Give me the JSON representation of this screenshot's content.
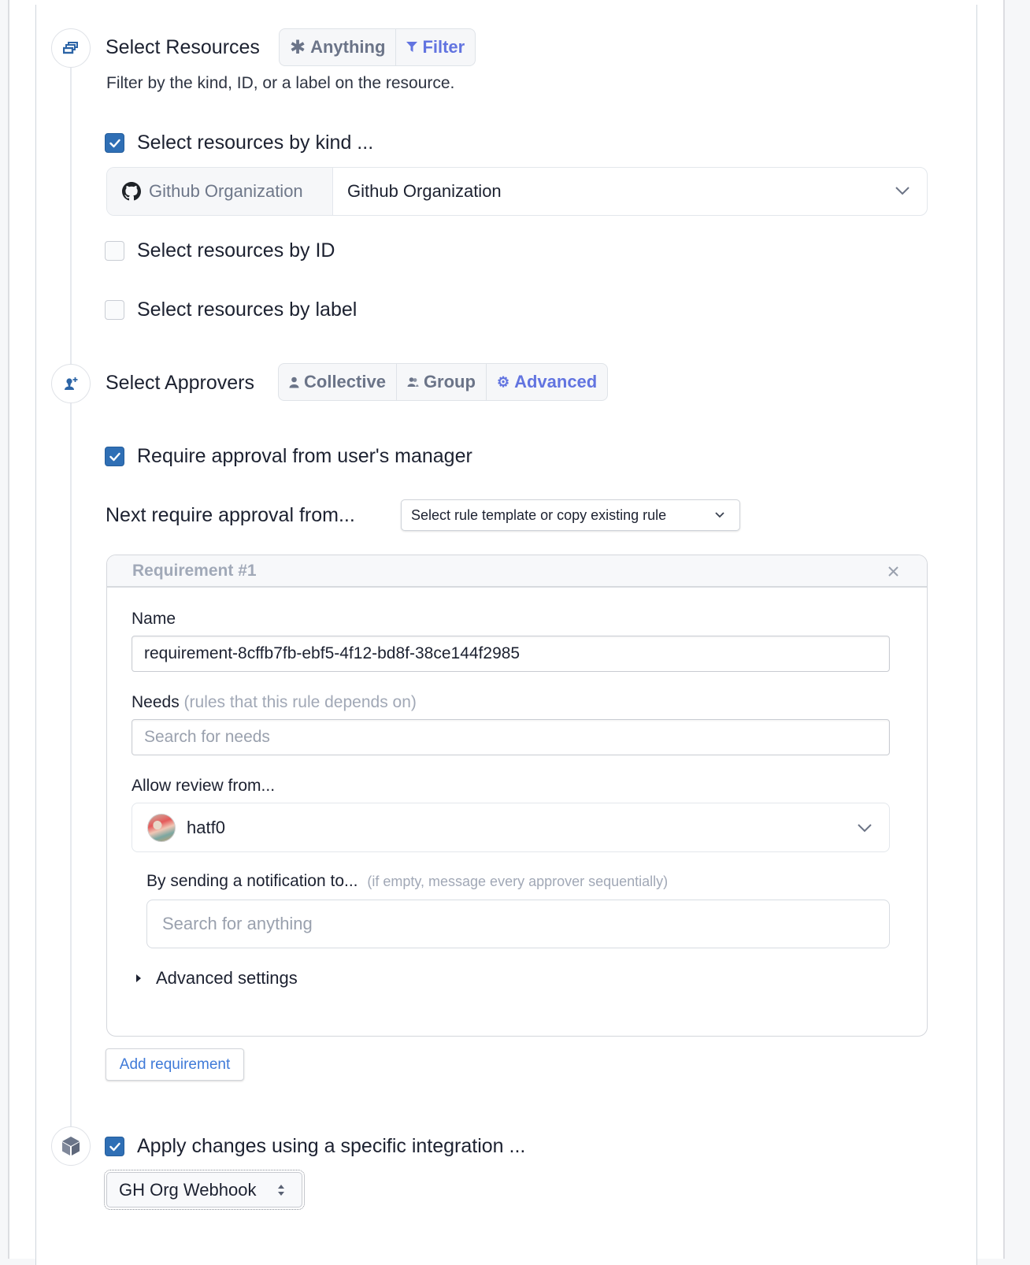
{
  "select_resources": {
    "title": "Select Resources",
    "modes": [
      {
        "label": "Anything",
        "icon": "asterisk-icon",
        "active": false
      },
      {
        "label": "Filter",
        "icon": "filter-icon",
        "active": true
      }
    ],
    "description": "Filter by the kind, ID, or a label on the resource.",
    "by_kind": {
      "label": "Select resources by kind ...",
      "checked": true,
      "prefix_label": "Github Organization",
      "value": "Github Organization"
    },
    "by_id": {
      "label": "Select resources by ID",
      "checked": false
    },
    "by_label": {
      "label": "Select resources by label",
      "checked": false
    }
  },
  "select_approvers": {
    "title": "Select Approvers",
    "modes": [
      {
        "label": "Collective",
        "icon": "user-icon",
        "active": false
      },
      {
        "label": "Group",
        "icon": "users-icon",
        "active": false
      },
      {
        "label": "Advanced",
        "icon": "gear-icon",
        "active": true
      }
    ],
    "require_manager": {
      "label": "Require approval from user's manager",
      "checked": true
    },
    "next_label": "Next require approval from...",
    "rule_template_select": "Select rule template or copy existing rule",
    "requirement": {
      "title": "Requirement #1",
      "name_label": "Name",
      "name_value": "requirement-8cffb7fb-ebf5-4f12-bd8f-38ce144f2985",
      "needs_label": "Needs",
      "needs_hint": "(rules that this rule depends on)",
      "needs_placeholder": "Search for needs",
      "review_label": "Allow review from...",
      "reviewer": "hatf0",
      "notify_label": "By sending a notification to...",
      "notify_hint": "(if empty, message every approver sequentially)",
      "notify_placeholder": "Search for anything",
      "advanced_label": "Advanced settings"
    },
    "add_requirement": "Add requirement"
  },
  "integration": {
    "label": "Apply changes using a specific integration ...",
    "checked": true,
    "value": "GH Org Webhook"
  },
  "colors": {
    "accent": "#6274e0",
    "checkbox": "#2f6fb5",
    "link": "#3f7ad8"
  }
}
